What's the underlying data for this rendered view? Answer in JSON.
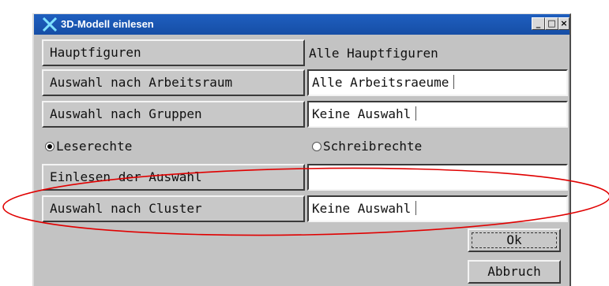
{
  "window": {
    "title": "3D-Modell einlesen",
    "controls": {
      "minimize": "_",
      "maximize": "□",
      "close": "×"
    }
  },
  "rows": {
    "hauptfiguren": {
      "button": "Hauptfiguren",
      "value": "Alle Hauptfiguren"
    },
    "arbeitsraum": {
      "button": "Auswahl nach Arbeitsraum",
      "value": "Alle Arbeitsraeume"
    },
    "gruppen": {
      "button": "Auswahl nach Gruppen",
      "value": "Keine Auswahl"
    },
    "einlesen": {
      "button": "Einlesen der Auswahl",
      "value": ""
    },
    "cluster": {
      "button": "Auswahl nach Cluster",
      "value": "Keine Auswahl"
    }
  },
  "radios": {
    "leserechte": {
      "label": "Leserechte",
      "checked": true
    },
    "schreibrechte": {
      "label": "Schreibrechte",
      "checked": false
    }
  },
  "buttons": {
    "ok": "Ok",
    "cancel": "Abbruch"
  },
  "colors": {
    "titlebar": "#1f5fbf",
    "dialog": "#c3c3c3",
    "annotation": "#e00000"
  }
}
